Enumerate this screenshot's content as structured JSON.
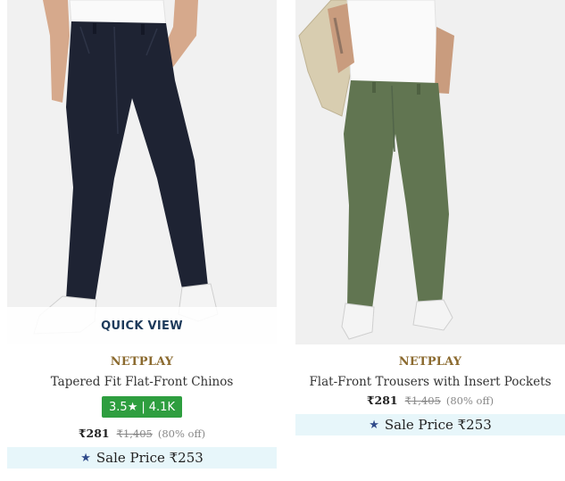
{
  "products": [
    {
      "image_alt": "person wearing navy tapered chinos with white sneakers",
      "quick_view_label": "QUICK VIEW",
      "brand": "NETPLAY",
      "name": "Tapered Fit Flat-Front Chinos",
      "rating": "3.5",
      "rating_star": "★",
      "rating_sep": "|",
      "rating_count": "4.1K",
      "price": "₹281",
      "mrp": "₹1,405",
      "discount": "(80% off)",
      "sale_label": "Sale Price ₹253",
      "pant_color": "#1e2333"
    },
    {
      "image_alt": "person wearing olive green flat-front trousers with white sneakers",
      "brand": "NETPLAY",
      "name": "Flat-Front Trousers with Insert Pockets",
      "price": "₹281",
      "mrp": "₹1,405",
      "discount": "(80% off)",
      "sale_label": "Sale Price ₹253",
      "pant_color": "#617551"
    }
  ],
  "colors": {
    "brand_text": "#8b6a2f",
    "rating_badge": "#2e9e3f",
    "sale_bar_bg": "#e7f6fa",
    "sale_star": "#2f4a8a",
    "quick_view_text": "#1d3a5b"
  }
}
